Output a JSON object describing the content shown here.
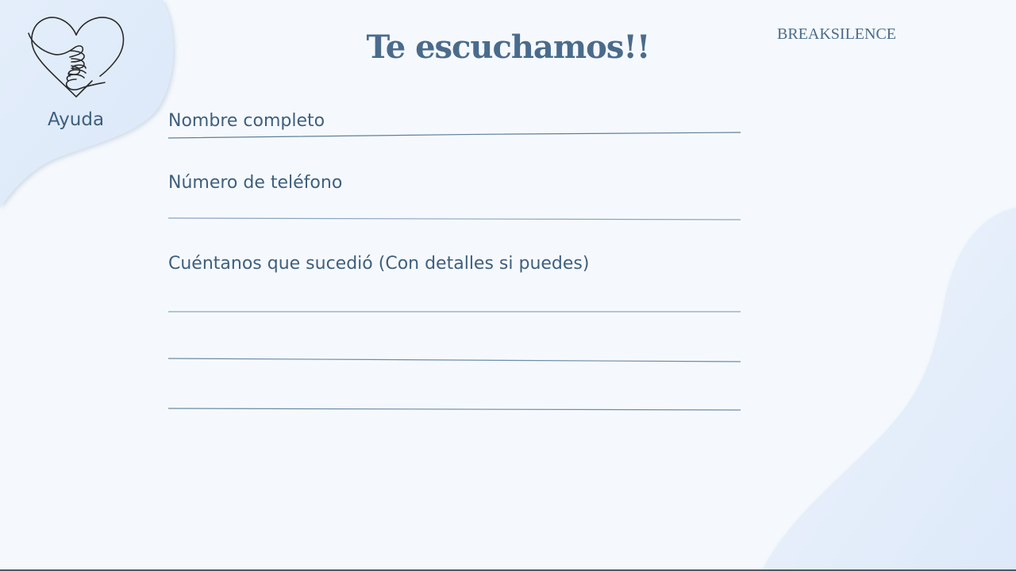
{
  "header": {
    "title": "Te escuchamos!!",
    "brand": "BREAKSILENCE"
  },
  "sidebar": {
    "help_label": "Ayuda",
    "logo_icon": "heart-hands-icon"
  },
  "form": {
    "name_label": "Nombre completo",
    "name_value": "",
    "phone_label": "Número de teléfono",
    "phone_value": "",
    "story_label": "Cuéntanos que sucedió (Con detalles si puedes)",
    "story_line1_value": "",
    "story_line2_value": "",
    "story_line3_value": ""
  },
  "colors": {
    "background": "#f5f9fd",
    "accent": "#4a6b8c",
    "text": "#3e5f7e",
    "line": "#6d8ca8"
  }
}
